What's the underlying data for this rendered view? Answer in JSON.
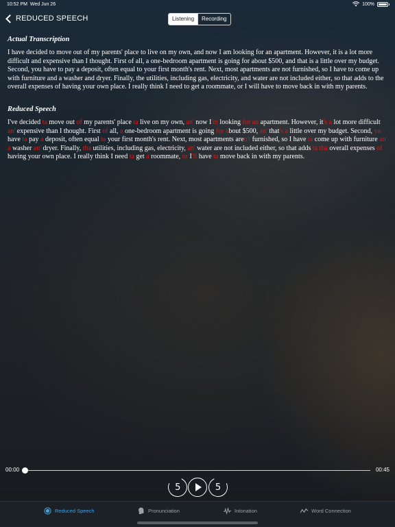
{
  "status": {
    "time": "10:52 PM",
    "date": "Wed Jun 26",
    "battery": "100%",
    "battery_level": 1.0
  },
  "nav": {
    "back_label": "REDUCED SPEECH",
    "segments": [
      "Listening",
      "Recording"
    ],
    "selected": "Listening"
  },
  "actual": {
    "title": "Actual Transcription",
    "text": "I have decided to move out of my parents' place to live on my own, and now I am looking for an apartment. However, it is a lot more difficult and expensive than I thought. First of all, a one-bedroom apartment is going for about $500, and that is a little over my budget. Second, you have to pay a deposit, often equal to your first month's rent. Next, most apartments are not furnished, so I have to come up with furniture and a washer and dryer. Finally, the utilities, including gas, electricity, and water are not included either, so that adds to the overall expenses of having your own place. I really think I need to get a roommate, or I will have to move back in with my parents."
  },
  "reduced": {
    "title": "Reduced Speech",
    "segments": [
      {
        "t": "I've decided "
      },
      {
        "t": "ta",
        "red": true
      },
      {
        "t": " move out "
      },
      {
        "t": "of",
        "red": true
      },
      {
        "t": " my parents' place "
      },
      {
        "t": "ta",
        "red": true
      },
      {
        "t": " live on my own, "
      },
      {
        "t": "an'",
        "red": true
      },
      {
        "t": " now I"
      },
      {
        "t": "'m",
        "red": true
      },
      {
        "t": " looking "
      },
      {
        "t": "for an",
        "red": true
      },
      {
        "t": " apartment. However, it"
      },
      {
        "t": "'s a",
        "red": true
      },
      {
        "t": " lot more difficult "
      },
      {
        "t": "an'",
        "red": true
      },
      {
        "t": " expensive than I thought. First "
      },
      {
        "t": "of",
        "red": true
      },
      {
        "t": " all, "
      },
      {
        "t": "a",
        "red": true
      },
      {
        "t": " one-bedroom apartment is going "
      },
      {
        "t": "for a",
        "red": true
      },
      {
        "t": "bout $500, "
      },
      {
        "t": "an'",
        "red": true
      },
      {
        "t": " that"
      },
      {
        "t": "'s a",
        "red": true
      },
      {
        "t": " little over my budget. Second, "
      },
      {
        "t": "ya",
        "red": true
      },
      {
        "t": " have "
      },
      {
        "t": "ta",
        "red": true
      },
      {
        "t": " pay "
      },
      {
        "t": "a",
        "red": true
      },
      {
        "t": " deposit, often equal "
      },
      {
        "t": "ta",
        "red": true
      },
      {
        "t": " your first month's rent. Next, most apartments are"
      },
      {
        "t": "n't",
        "red": true
      },
      {
        "t": " furnished, so I have "
      },
      {
        "t": "ta",
        "red": true
      },
      {
        "t": " come up with furniture "
      },
      {
        "t": "an' a",
        "red": true
      },
      {
        "t": " washer "
      },
      {
        "t": "an'",
        "red": true
      },
      {
        "t": " dryer. Finally, "
      },
      {
        "t": "tha",
        "red": true
      },
      {
        "t": " utilities, including gas, electricity, "
      },
      {
        "t": "an'",
        "red": true
      },
      {
        "t": " water are not included either, so that adds "
      },
      {
        "t": "ta tha",
        "red": true
      },
      {
        "t": " overall expenses "
      },
      {
        "t": "of",
        "red": true
      },
      {
        "t": " having your own place. I really think I need "
      },
      {
        "t": "ta",
        "red": true
      },
      {
        "t": " get "
      },
      {
        "t": "a",
        "red": true
      },
      {
        "t": " roommate, "
      },
      {
        "t": "or",
        "red": true
      },
      {
        "t": " I"
      },
      {
        "t": "'ll",
        "red": true
      },
      {
        "t": " have "
      },
      {
        "t": "ta",
        "red": true
      },
      {
        "t": " move back in with my parents."
      }
    ]
  },
  "player": {
    "current": "00:00",
    "duration": "00:45",
    "progress": 0,
    "skip_back": "5",
    "skip_forward": "5"
  },
  "tabs": [
    {
      "label": "Reduced Speech",
      "icon": "reduced-speech-icon",
      "active": true
    },
    {
      "label": "Pronunciation",
      "icon": "head-speaking-icon",
      "active": false
    },
    {
      "label": "Intonation",
      "icon": "waveform-icon",
      "active": false
    },
    {
      "label": "Word Connection",
      "icon": "connection-icon",
      "active": false
    }
  ],
  "colors": {
    "accent": "#3aa3e3",
    "reduced": "#d01d1d"
  }
}
